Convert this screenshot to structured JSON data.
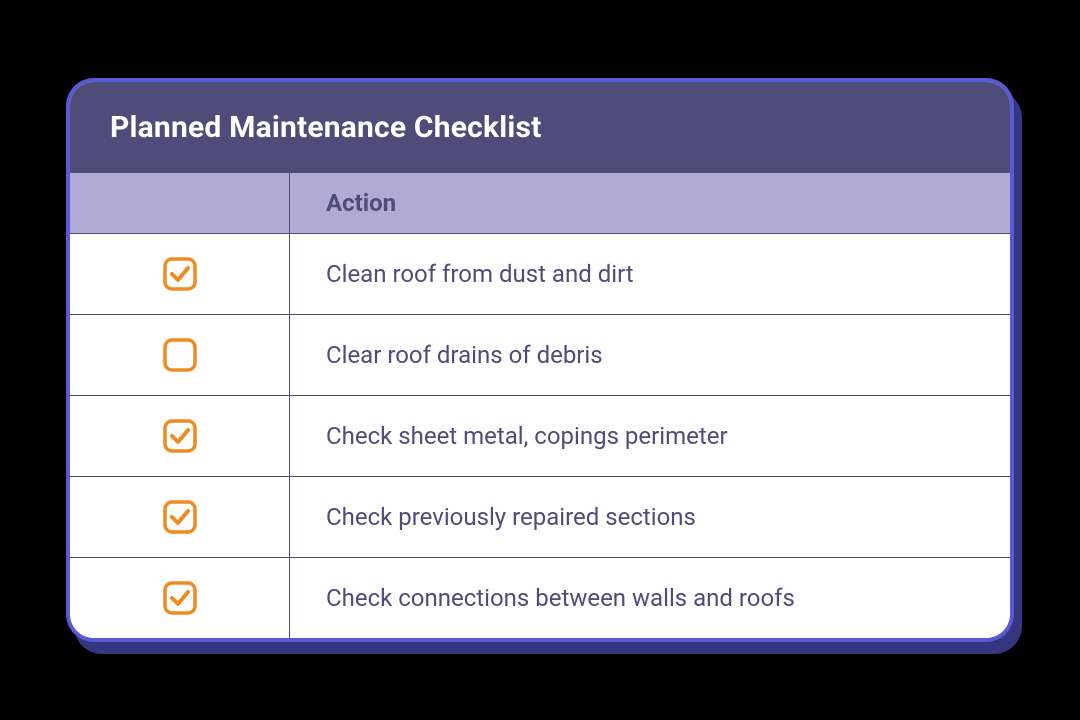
{
  "title": "Planned Maintenance Checklist",
  "column_header": "Action",
  "colors": {
    "accent_orange": "#ee8c21",
    "header_bg": "#4e4d7a",
    "subheader_bg": "#b1aad5",
    "text": "#4e4d7a",
    "border_outer": "#5a5ad6"
  },
  "items": [
    {
      "checked": true,
      "label": "Clean roof from dust and dirt"
    },
    {
      "checked": false,
      "label": "Clear roof drains of debris"
    },
    {
      "checked": true,
      "label": "Check sheet metal, copings perimeter"
    },
    {
      "checked": true,
      "label": "Check previously repaired sections"
    },
    {
      "checked": true,
      "label": "Check connections between walls and roofs"
    }
  ]
}
